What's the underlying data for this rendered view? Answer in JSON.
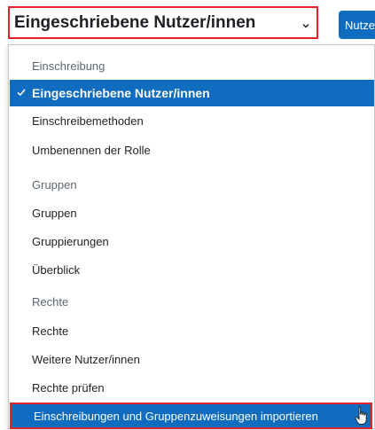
{
  "select": {
    "label": "Eingeschriebene Nutzer/innen"
  },
  "button": {
    "label": "Nutzer"
  },
  "menu": {
    "groups": [
      {
        "header": "Einschreibung",
        "items": [
          "Eingeschriebene Nutzer/innen",
          "Einschreibemethoden",
          "Umbenennen der Rolle"
        ]
      },
      {
        "header": "Gruppen",
        "items": [
          "Gruppen",
          "Gruppierungen",
          "Überblick"
        ]
      },
      {
        "header": "Rechte",
        "items": [
          "Rechte",
          "Weitere Nutzer/innen",
          "Rechte prüfen",
          "Einschreibungen und Gruppenzuweisungen importieren"
        ]
      }
    ]
  },
  "icons": {
    "check": "check-icon",
    "caret": "chevron-down-icon",
    "cursor": "hand-pointer-icon"
  },
  "colors": {
    "accent": "#0f6cbf",
    "highlight_border": "#e3242b",
    "text": "#1d2125",
    "muted": "#5c6670"
  }
}
